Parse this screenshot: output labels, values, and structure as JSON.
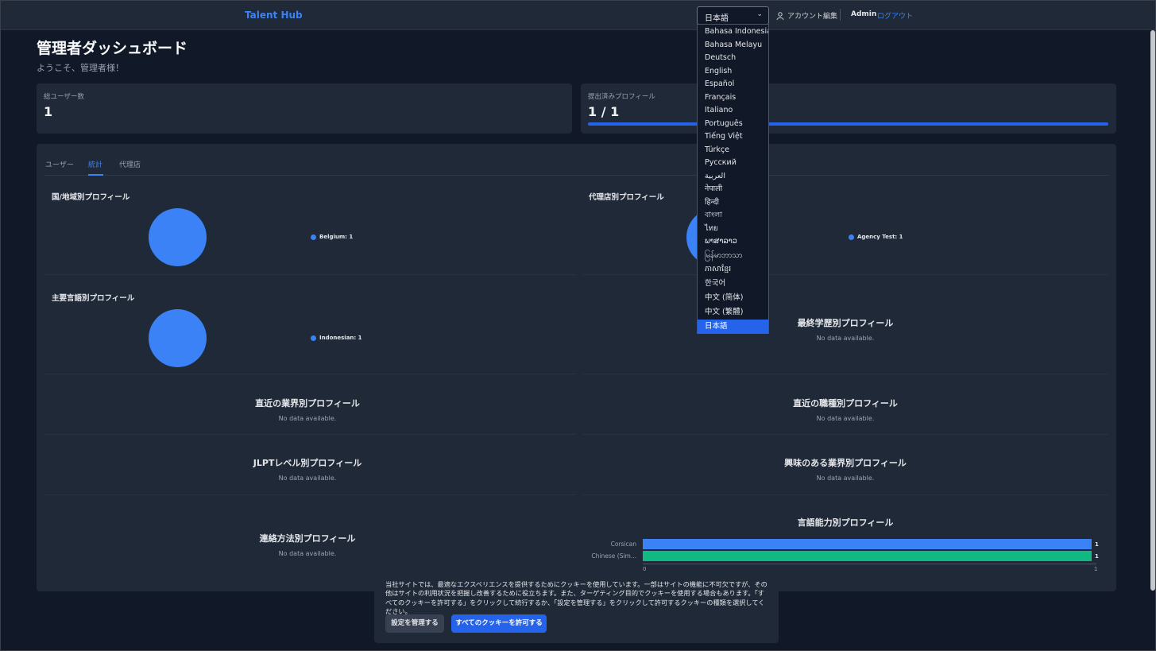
{
  "header": {
    "brand": "Talent Hub",
    "language_selected": "日本語",
    "account_edit": "アカウント編集",
    "user_name": "Admin",
    "logout": "ログアウト"
  },
  "language_options": [
    "Bahasa Indonesia",
    "Bahasa Melayu",
    "Deutsch",
    "English",
    "Español",
    "Français",
    "Italiano",
    "Português",
    "Tiếng Việt",
    "Türkçe",
    "Русский",
    "العربية",
    "नेपाली",
    "हिन्दी",
    "বাংলা",
    "ไทย",
    "ພາສາລາວ",
    "မြန်မာဘာသာ",
    "ភាសាខ្មែរ",
    "한국어",
    "中文 (简体)",
    "中文 (繁體)",
    "日本語"
  ],
  "page": {
    "title": "管理者ダッシュボード",
    "welcome": "ようこそ、管理者様！"
  },
  "stats": {
    "total_users_label": "総ユーザー数",
    "total_users_value": "1",
    "submitted_label": "提出済みプロフィール",
    "submitted_value": "1 / 1",
    "submitted_progress": 1.0
  },
  "tabs": [
    "ユーザー",
    "統計",
    "代理店"
  ],
  "active_tab": "統計",
  "sections": {
    "country": {
      "title": "国/地域別プロフィール",
      "legend": "Belgium: 1"
    },
    "agency": {
      "title": "代理店別プロフィール",
      "legend": "Agency Test: 1"
    },
    "language": {
      "title": "主要言語別プロフィール",
      "legend": "Indonesian: 1"
    },
    "education": {
      "title": "最終学歴別プロフィール",
      "nodata": "No data available."
    },
    "industry": {
      "title": "直近の業界別プロフィール",
      "nodata": "No data available."
    },
    "job_type": {
      "title": "直近の職種別プロフィール",
      "nodata": "No data available."
    },
    "jlpt": {
      "title": "JLPTレベル別プロフィール",
      "nodata": "No data available."
    },
    "interest": {
      "title": "興味のある業界別プロフィール",
      "nodata": "No data available."
    },
    "contact": {
      "title": "連絡方法別プロフィール",
      "nodata": "No data available."
    },
    "ability": {
      "title": "言語能力別プロフィール"
    }
  },
  "chart_data": {
    "type": "bar",
    "title": "言語能力別プロフィール",
    "categories": [
      "Corsican",
      "Chinese (Sim..."
    ],
    "values": [
      1,
      1
    ],
    "colors": [
      "#3b82f6",
      "#10b981"
    ],
    "xlim": [
      0,
      1
    ],
    "x_ticks": [
      "0",
      "1"
    ]
  },
  "cookie": {
    "text": "当社サイトでは、最適なエクスペリエンスを提供するためにクッキーを使用しています。一部はサイトの機能に不可欠ですが、その他はサイトの利用状況を把握し改善するために役立ちます。また、ターゲティング目的でクッキーを使用する場合もあります。「すべてのクッキーを許可する」をクリックして続行するか、「設定を管理する」をクリックして許可するクッキーの種類を選択してください。",
    "manage_button": "設定を管理する",
    "accept_button": "すべてのクッキーを許可する"
  }
}
